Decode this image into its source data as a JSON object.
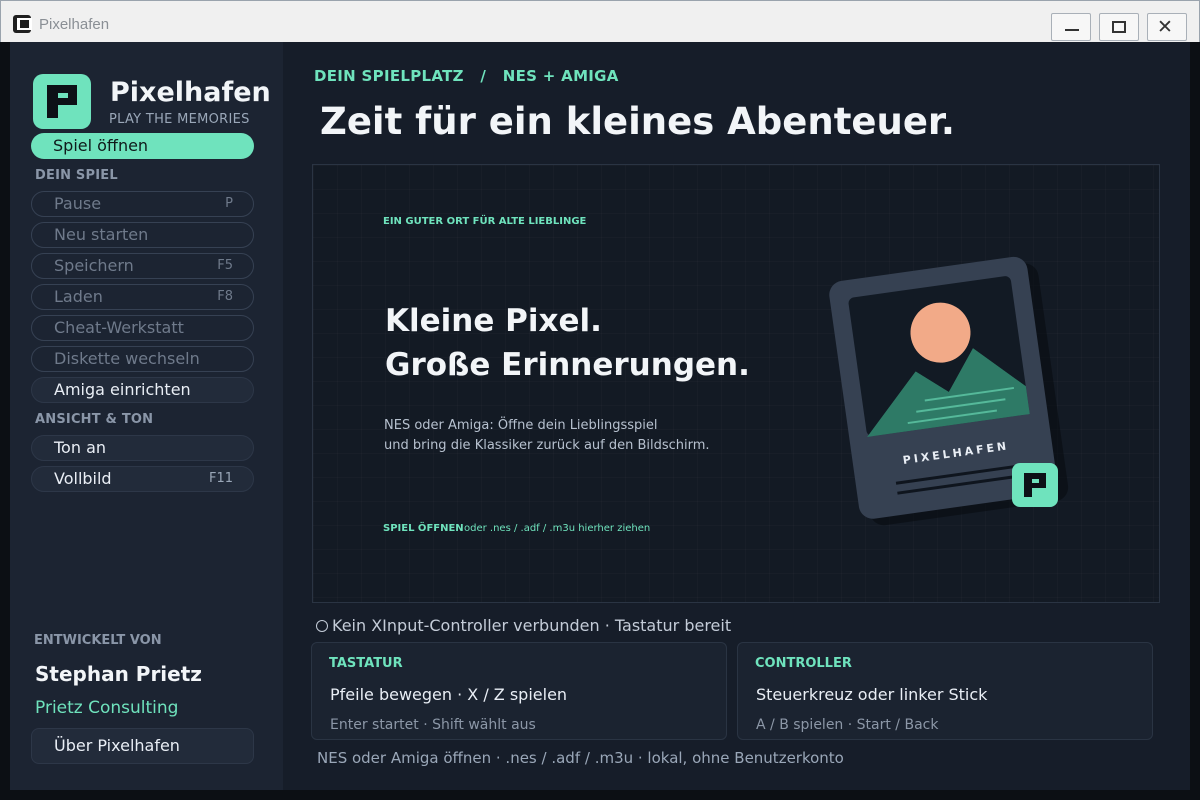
{
  "window": {
    "title": "Pixelhafen",
    "minimize": "—",
    "maximize": "□",
    "close": "✕"
  },
  "sidebar": {
    "logo_icon": "pixelhafen-p-logo",
    "brand": "Pixelhafen",
    "tagline": "PLAY THE MEMORIES",
    "open_game": "Spiel öffnen",
    "section_game": "DEIN SPIEL",
    "game_items": [
      {
        "label": "Pause",
        "key": "P"
      },
      {
        "label": "Neu starten",
        "key": ""
      },
      {
        "label": "Speichern",
        "key": "F5"
      },
      {
        "label": "Laden",
        "key": "F8"
      },
      {
        "label": "Cheat-Werkstatt",
        "key": ""
      },
      {
        "label": "Diskette wechseln",
        "key": ""
      },
      {
        "label": "Amiga einrichten",
        "key": ""
      }
    ],
    "section_view": "ANSICHT & TON",
    "view_items": [
      {
        "label": "Ton an",
        "key": ""
      },
      {
        "label": "Vollbild",
        "key": "F11"
      }
    ],
    "developed_by_label": "ENTWICKELT VON",
    "developer": "Stephan Prietz",
    "company": "Prietz Consulting",
    "about": "Über Pixelhafen"
  },
  "main": {
    "breadcrumb": "DEIN SPIELPLATZ   /   NES + AMIGA",
    "headline": "Zeit für ein kleines Abenteuer.",
    "hero": {
      "kicker": "EIN GUTER ORT FÜR ALTE LIEBLINGE",
      "title_line1": "Kleine Pixel.",
      "title_line2": "Große Erinnerungen.",
      "text_line1": "NES oder Amiga: Öffne dein Lieblingsspiel",
      "text_line2": "und bring die Klassiker zurück auf den Bildschirm.",
      "cta": "SPIEL ÖFFNEN",
      "drop_hint": "oder .nes / .adf / .m3u hierher ziehen",
      "card_label": "PIXELHAFEN"
    },
    "status": "Kein XInput-Controller verbunden · Tastatur bereit",
    "panels": [
      {
        "title": "TASTATUR",
        "main": "Pfeile bewegen · X / Z spielen",
        "sub": "Enter startet · Shift wählt aus"
      },
      {
        "title": "CONTROLLER",
        "main": "Steuerkreuz oder linker Stick",
        "sub": "A / B spielen · Start / Back"
      }
    ],
    "footer": "NES oder Amiga öffnen · .nes / .adf / .m3u · lokal, ohne Benutzerkonto"
  },
  "colors": {
    "accent": "#6fe3bd",
    "sidebar_bg": "#1c2432",
    "main_bg": "#161d29",
    "card_peach": "#f2aa88",
    "card_mountain": "#2f7a66"
  }
}
